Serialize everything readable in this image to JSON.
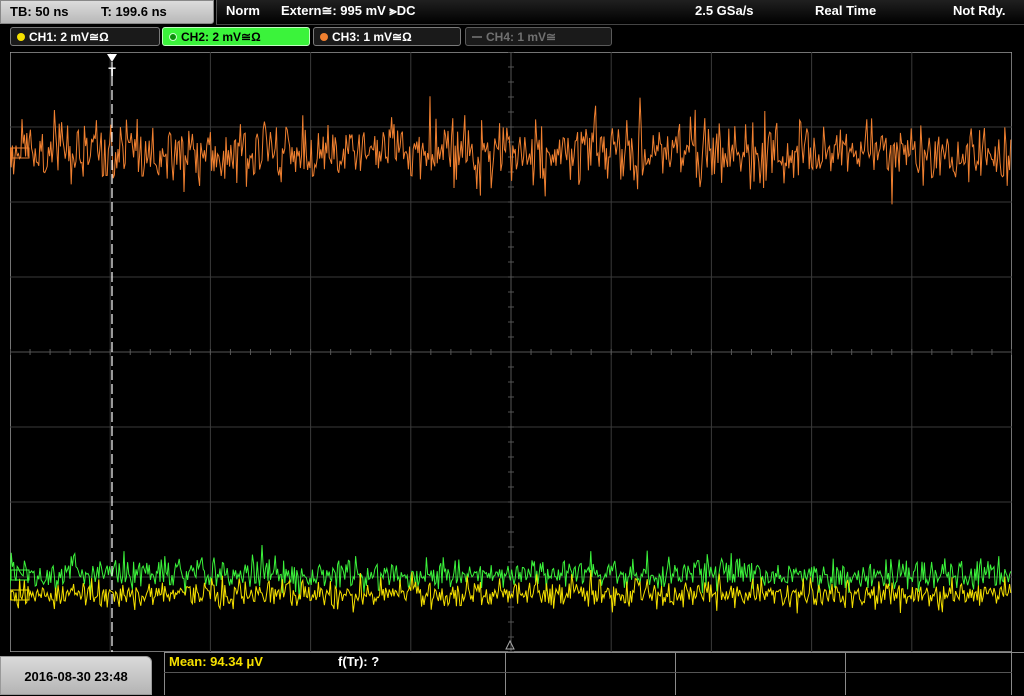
{
  "header": {
    "timebase": "TB: 50 ns",
    "trigger_time": "T: 199.6 ns",
    "trigger_mode": "Norm",
    "trigger_source": "Extern≅: 995 mV ⪢DC",
    "sample_rate": "2.5 GSa/s",
    "acq_mode": "Real Time",
    "status": "Not Rdy."
  },
  "channels": [
    {
      "label": "CH1: 2 mV≅Ω",
      "color": "#f5e000",
      "active": false
    },
    {
      "label": "CH2: 2 mV≅Ω",
      "color": "#3bf33b",
      "active": true
    },
    {
      "label": "CH3: 1 mV≅Ω",
      "color": "#f08030",
      "active": false
    },
    {
      "label": "CH4: 1 mV≅",
      "color": "#707070",
      "active": false
    }
  ],
  "footer": {
    "datetime": "2016-08-30 23:48",
    "mean": "Mean: 94.34 μV",
    "ftr": "f(Tr): ?"
  },
  "icons": {
    "trigger_marker": "trigger-t-marker-icon",
    "channel_ref_markers": "channel-reference-marker-icon"
  }
}
